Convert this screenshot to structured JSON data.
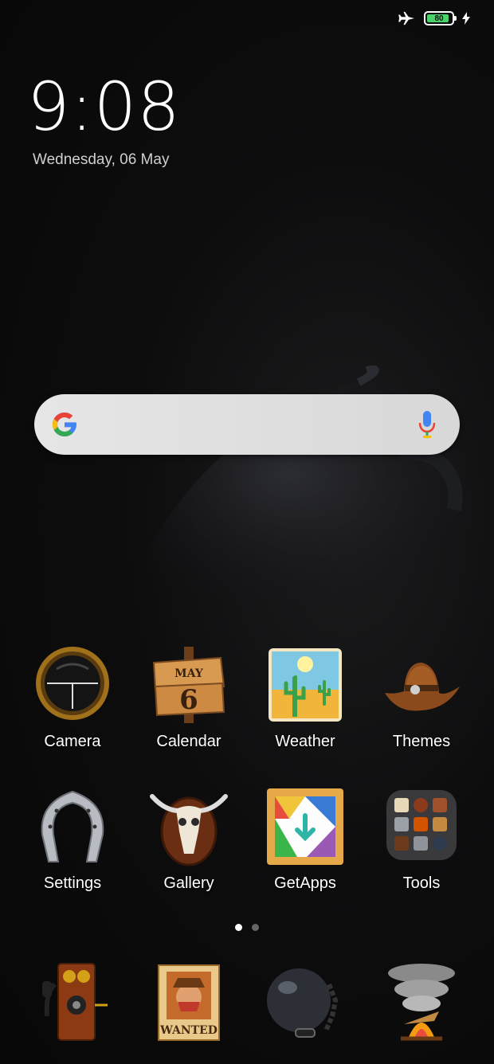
{
  "status_bar": {
    "airplane_icon": "airplane-icon",
    "battery_level": "80",
    "charging_icon": "bolt-icon"
  },
  "lock": {
    "time": "9:08",
    "date": "Wednesday, 06 May"
  },
  "search_bar": {
    "logo": "google-g-icon",
    "mic": "microphone-icon"
  },
  "apps": [
    {
      "label": "Camera",
      "icon": "camera-icon"
    },
    {
      "label": "Calendar",
      "icon": "calendar-sign-icon",
      "sign_month": "MAY",
      "sign_day": "6"
    },
    {
      "label": "Weather",
      "icon": "desert-cactus-icon"
    },
    {
      "label": "Themes",
      "icon": "cowboy-hat-icon"
    },
    {
      "label": "Settings",
      "icon": "horseshoe-icon"
    },
    {
      "label": "Gallery",
      "icon": "bull-skull-icon"
    },
    {
      "label": "GetApps",
      "icon": "getapps-icon"
    },
    {
      "label": "Tools",
      "icon": "folder-icon"
    }
  ],
  "page_indicator": {
    "pages": 2,
    "current": 1
  },
  "dock": [
    {
      "icon": "old-telephone-icon"
    },
    {
      "icon": "wanted-poster-icon",
      "poster_text": "WANTED"
    },
    {
      "icon": "ball-and-chain-icon"
    },
    {
      "icon": "campfire-smoke-icon"
    }
  ]
}
